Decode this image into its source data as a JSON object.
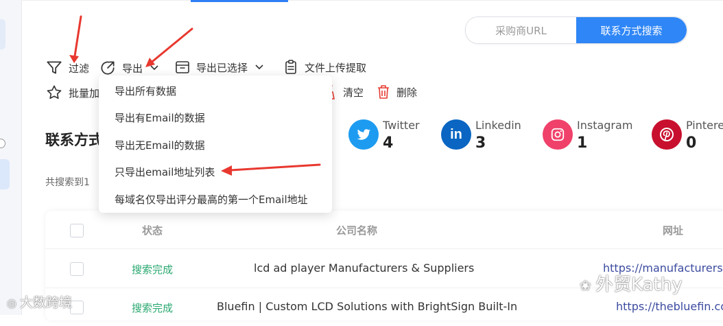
{
  "mode_toggle": {
    "buyer_url_label": "采购商URL",
    "contact_search_label": "联系方式搜索"
  },
  "toolbar": {
    "filter_label": "过滤",
    "export_label": "导出",
    "export_selected_label": "导出已选择",
    "upload_extract_label": "文件上传提取",
    "batch_add_label": "批量加",
    "clear_label": "清空",
    "delete_label": "删除"
  },
  "export_menu": {
    "items": [
      "导出所有数据",
      "导出有Email的数据",
      "导出无Email的数据",
      "只导出email地址列表",
      "每域名仅导出评分最高的第一个Email地址"
    ]
  },
  "section": {
    "title": "联系方式",
    "result_count": "共搜索到1"
  },
  "socials": [
    {
      "name": "Twitter",
      "count": "4",
      "icon": "twitter-icon",
      "color": "#1d9bf0"
    },
    {
      "name": "Linkedin",
      "count": "3",
      "icon": "linkedin-icon",
      "color": "#0a66c2"
    },
    {
      "name": "Instagram",
      "count": "1",
      "icon": "instagram-icon",
      "color": "#f0416a"
    },
    {
      "name": "Pintere",
      "count": "0",
      "icon": "pinterest-icon",
      "color": "#c8102e"
    }
  ],
  "table": {
    "headers": [
      "状态",
      "公司名称",
      "网址"
    ],
    "rows": [
      {
        "status": "搜索完成",
        "company": "lcd ad player Manufacturers & Suppliers",
        "url": "https://manufacturerss."
      },
      {
        "status": "搜索完成",
        "company": "Bluefin | Custom LCD Solutions with BrightSign Built-In",
        "url": "https://thebluefin.co"
      }
    ]
  },
  "watermarks": {
    "left": "大数跨境",
    "right": "外贸Kathy"
  },
  "colors": {
    "accent": "#2f86f6",
    "status_done": "#2aa870",
    "annotation_arrow": "#e8382f"
  }
}
